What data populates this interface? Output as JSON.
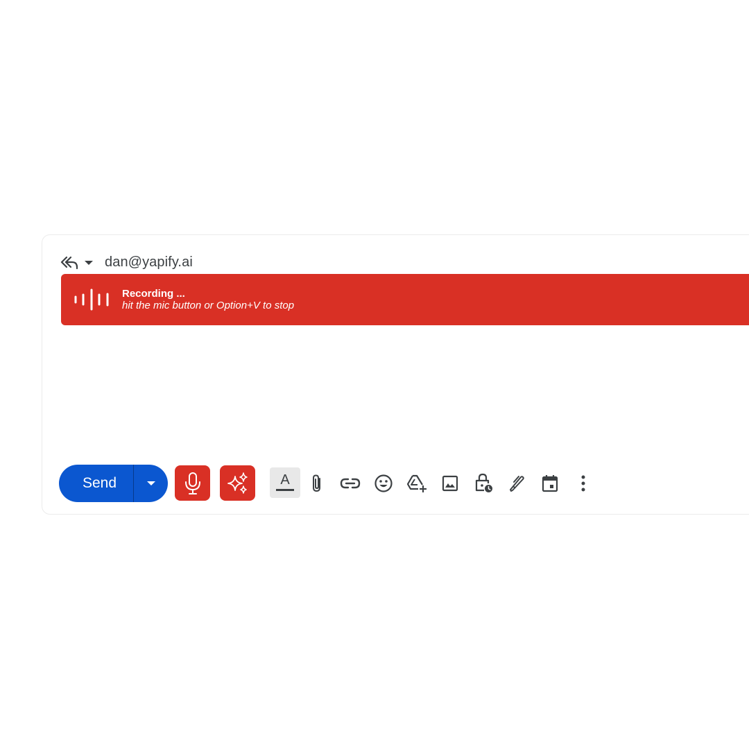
{
  "compose": {
    "recipient": "dan@yapify.ai",
    "recording_banner": {
      "title": "Recording ...",
      "subtitle": "hit the mic button or Option+V to stop",
      "color": "#d93025"
    },
    "toolbar": {
      "send_label": "Send",
      "send_color": "#0b57d0",
      "format_letter": "A",
      "icons": [
        "formatting-icon",
        "attachment-icon",
        "link-icon",
        "emoji-icon",
        "drive-icon",
        "photo-icon",
        "confidential-mode-icon",
        "signature-icon",
        "schedule-icon",
        "more-options-icon"
      ]
    }
  }
}
